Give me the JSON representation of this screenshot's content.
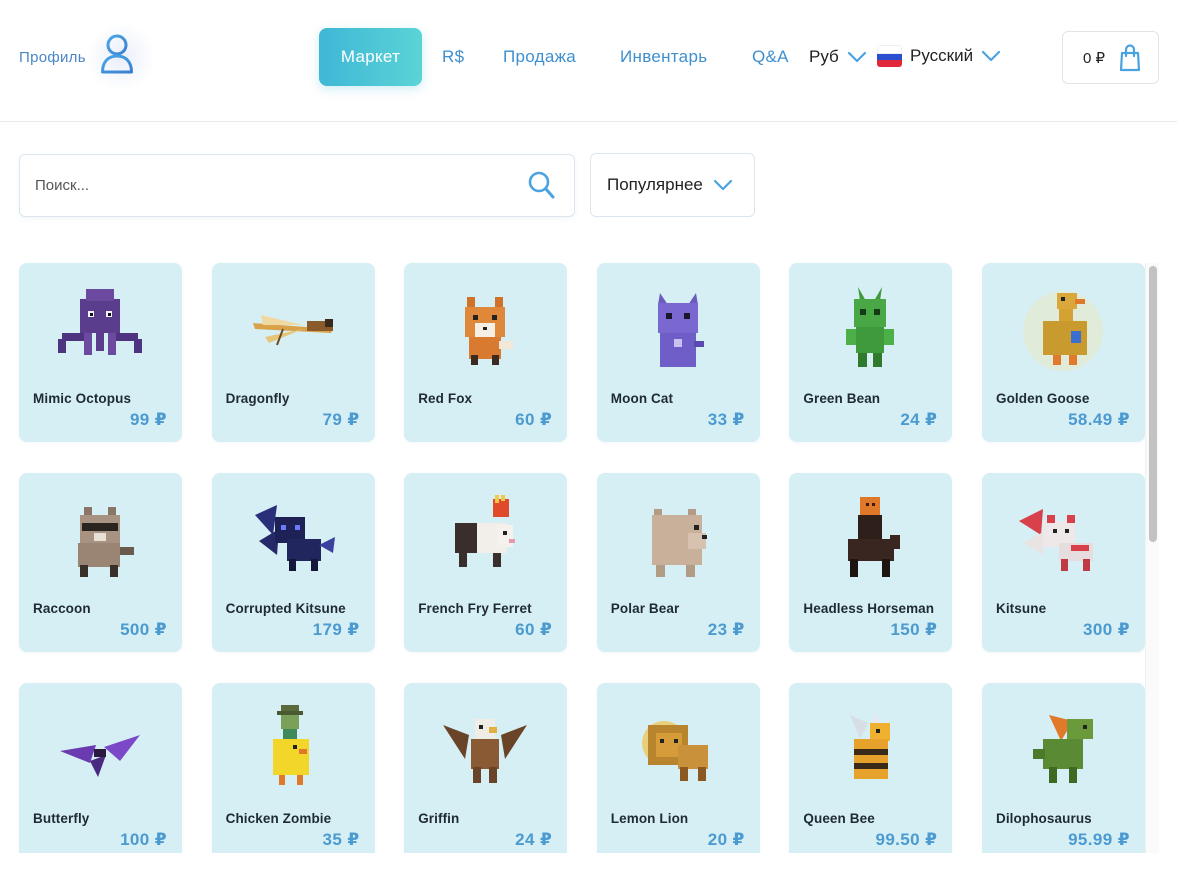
{
  "header": {
    "profile_label": "Профиль",
    "nav": {
      "market": "Маркет",
      "robux": "R$",
      "sell": "Продажа",
      "inventory": "Инвентарь",
      "qa": "Q&A"
    },
    "currency": "Руб",
    "language": "Русский",
    "cart_total": "0 ₽"
  },
  "toolbar": {
    "search_placeholder": "Поиск...",
    "sort_label": "Популярнее"
  },
  "items": [
    {
      "name": "Mimic Octopus",
      "price": "99 ₽"
    },
    {
      "name": "Dragonfly",
      "price": "79 ₽"
    },
    {
      "name": "Red Fox",
      "price": "60 ₽"
    },
    {
      "name": "Moon Cat",
      "price": "33 ₽"
    },
    {
      "name": "Green Bean",
      "price": "24 ₽"
    },
    {
      "name": "Golden Goose",
      "price": "58.49 ₽"
    },
    {
      "name": "Raccoon",
      "price": "500 ₽"
    },
    {
      "name": "Corrupted Kitsune",
      "price": "179 ₽"
    },
    {
      "name": "French Fry Ferret",
      "price": "60 ₽"
    },
    {
      "name": "Polar Bear",
      "price": "23 ₽"
    },
    {
      "name": "Headless Horseman",
      "price": "150 ₽"
    },
    {
      "name": "Kitsune",
      "price": "300 ₽"
    },
    {
      "name": "Butterfly",
      "price": "100 ₽"
    },
    {
      "name": "Chicken Zombie",
      "price": "35 ₽"
    },
    {
      "name": "Griffin",
      "price": "24 ₽"
    },
    {
      "name": "Lemon Lion",
      "price": "20 ₽"
    },
    {
      "name": "Queen Bee",
      "price": "99.50 ₽"
    },
    {
      "name": "Dilophosaurus",
      "price": "95.99 ₽"
    }
  ],
  "colors": {
    "accent": "#3fb7d6",
    "link": "#3e8fcf",
    "card_bg": "#d6eff5",
    "price": "#4b9ad0"
  }
}
